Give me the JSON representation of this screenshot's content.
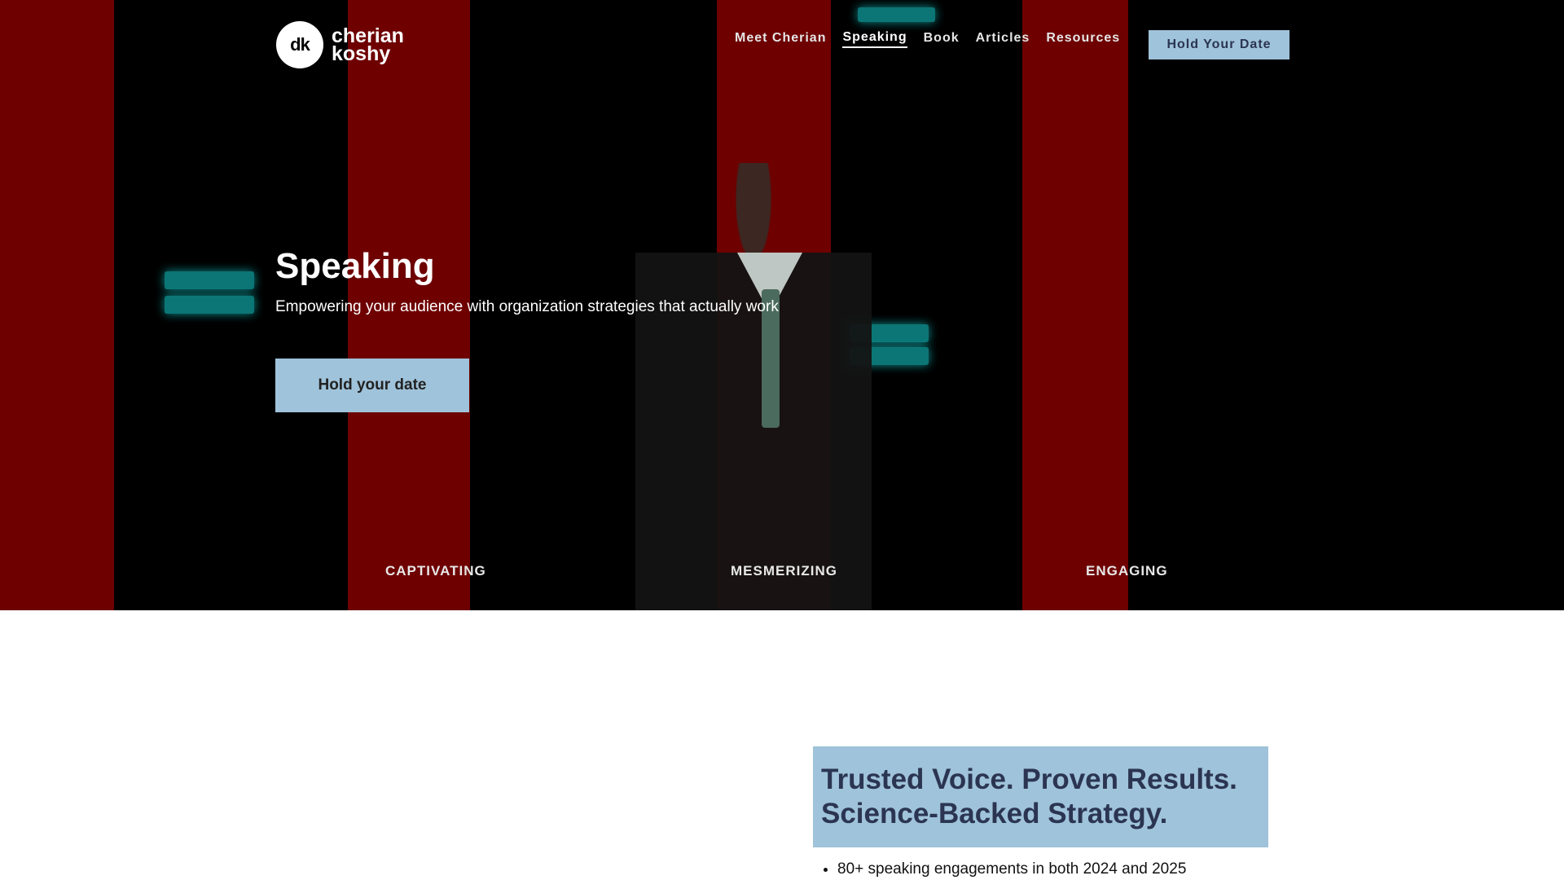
{
  "logo": {
    "mark": "dk",
    "line1": "cherian",
    "line2": "koshy"
  },
  "nav": {
    "links": [
      "Meet Cherian",
      "Speaking",
      "Book",
      "Articles",
      "Resources"
    ],
    "active": "Speaking",
    "cta": "Hold Your Date"
  },
  "hero": {
    "title": "Speaking",
    "subtitle": "Empowering your audience with organization strategies that actually work",
    "cta": "Hold your date",
    "traits": [
      "CAPTIVATING",
      "MESMERIZING",
      "ENGAGING"
    ]
  },
  "trusted": {
    "title_line1": "Trusted Voice. Proven Results.",
    "title_line2": "Science-Backed Strategy.",
    "bullets": [
      "80+ speaking engagements in both 2024 and 2025"
    ]
  },
  "colors": {
    "accent": "#9fc3da",
    "navy": "#2b3552",
    "stage_red": "#6e0000",
    "stage_teal": "#0f8a8a"
  }
}
